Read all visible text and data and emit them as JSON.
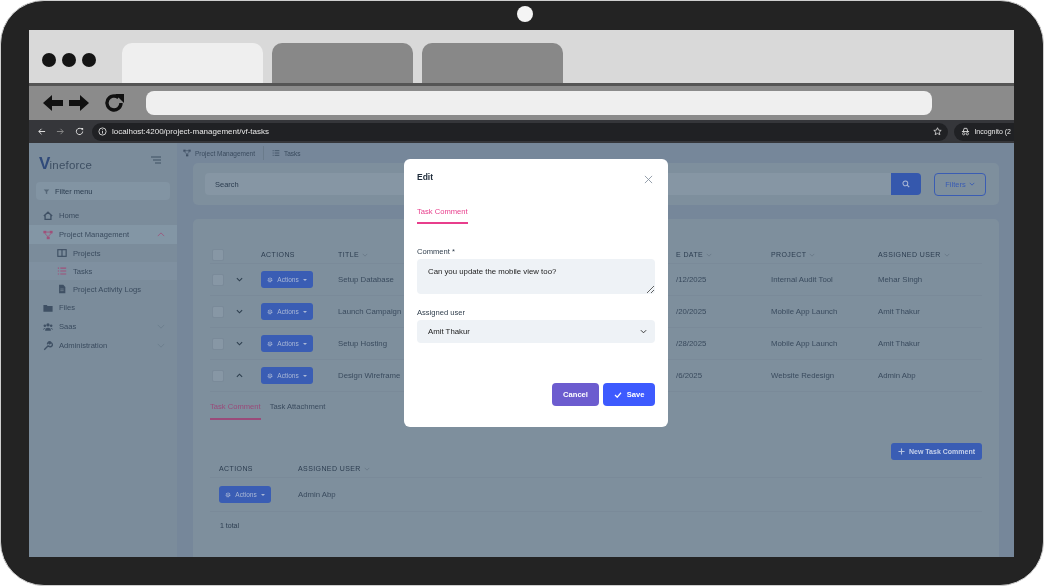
{
  "mockup_tabs": [
    {
      "selected": true
    },
    {
      "selected": false
    },
    {
      "selected": false
    }
  ],
  "browser": {
    "url": "localhost:4200/project-management/vf-tasks",
    "profile": "Incognito (2"
  },
  "sidebar": {
    "logo_mark": "V",
    "logo_text": "ineforce",
    "filter_placeholder": "Filter menu",
    "items": [
      {
        "label": "Home",
        "kind": "home",
        "selected": false
      },
      {
        "label": "Project Management",
        "kind": "tree",
        "selected": true,
        "expanded": true,
        "children": [
          {
            "label": "Projects",
            "kind": "columns",
            "selected": false
          },
          {
            "label": "Tasks",
            "kind": "list",
            "selected": true
          },
          {
            "label": "Project Activity Logs",
            "kind": "doc",
            "selected": false
          }
        ]
      },
      {
        "label": "Files",
        "kind": "folder",
        "selected": false
      },
      {
        "label": "Saas",
        "kind": "users",
        "selected": false,
        "expanded": false
      },
      {
        "label": "Administration",
        "kind": "wrench",
        "selected": false,
        "expanded": false
      }
    ]
  },
  "breadcrumb": [
    {
      "label": "Project Management",
      "kind": "tree"
    },
    {
      "label": "Tasks",
      "kind": "list"
    }
  ],
  "search": {
    "placeholder": "Search"
  },
  "filters_button": "Filters",
  "table": {
    "select_all_checked": false,
    "columns": [
      {
        "label": "ACTIONS",
        "sortable": false
      },
      {
        "label": "TITLE",
        "sortable": true
      },
      {
        "label": "E DATE",
        "sortable": true
      },
      {
        "label": "PROJECT",
        "sortable": true
      },
      {
        "label": "ASSIGNED USER",
        "sortable": true
      }
    ],
    "rows": [
      {
        "checked": false,
        "expanded": false,
        "actions": "Actions",
        "title": "Setup Database",
        "due": "/12/2025",
        "project": "Internal Audit Tool",
        "user": "Mehar Singh"
      },
      {
        "checked": false,
        "expanded": false,
        "actions": "Actions",
        "title": "Launch Campaign",
        "due": "/20/2025",
        "project": "Mobile App Launch",
        "user": "Amit Thakur"
      },
      {
        "checked": false,
        "expanded": false,
        "actions": "Actions",
        "title": "Setup Hosting",
        "due": "/28/2025",
        "project": "Mobile App Launch",
        "user": "Amit Thakur"
      },
      {
        "checked": false,
        "expanded": true,
        "actions": "Actions",
        "title": "Design Wireframe",
        "due": "/6/2025",
        "project": "Website Redesign",
        "user": "Admin Abp"
      }
    ]
  },
  "detail_tabs": [
    {
      "label": "Task Comment",
      "selected": true
    },
    {
      "label": "Task Attachment",
      "selected": false
    }
  ],
  "new_button": "New Task Comment",
  "subtable": {
    "columns": [
      {
        "label": "ACTIONS",
        "sortable": false
      },
      {
        "label": "ASSIGNED USER",
        "sortable": true
      }
    ],
    "rows": [
      {
        "actions": "Actions",
        "user": "Admin Abp"
      }
    ],
    "total": "1 total"
  },
  "modal": {
    "title": "Edit",
    "tabs": [
      {
        "label": "Task Comment",
        "selected": true
      }
    ],
    "comment_label": "Comment *",
    "comment_value": "Can you update the mobile view too?",
    "user_label": "Assigned user",
    "user_value": "Amit Thakur",
    "cancel": "Cancel",
    "save": "Save"
  }
}
